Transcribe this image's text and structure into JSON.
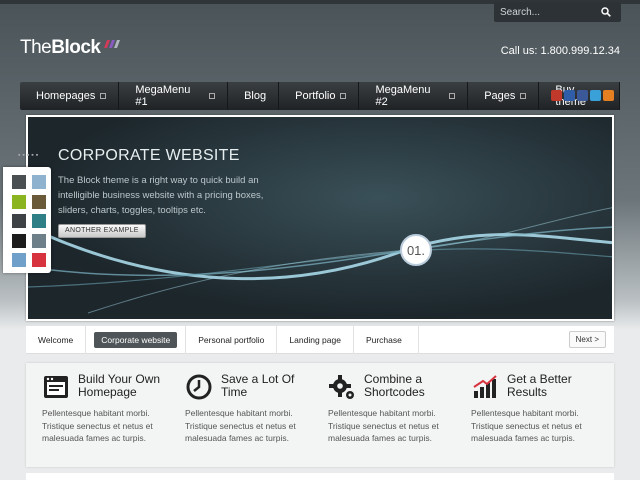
{
  "header": {
    "logo_light": "The",
    "logo_bold": "Block",
    "phone": "Call us: 1.800.999.12.34",
    "search": {
      "placeholder": "Search..."
    }
  },
  "nav": {
    "items": [
      {
        "label": "Homepages",
        "has_sub": true
      },
      {
        "label": "MegaMenu #1",
        "has_sub": true
      },
      {
        "label": "Blog",
        "has_sub": false
      },
      {
        "label": "Portfolio",
        "has_sub": true
      },
      {
        "label": "MegaMenu #2",
        "has_sub": true
      },
      {
        "label": "Pages",
        "has_sub": true
      },
      {
        "label": "Buy theme",
        "has_sub": false
      }
    ],
    "social_icons": [
      "youtube-icon",
      "flickr-icon",
      "facebook-icon",
      "twitter-icon",
      "rss-icon"
    ]
  },
  "slider": {
    "title": "CORPORATE WEBSITE",
    "text": "The Block theme is a right way to quick build an intelligible business website with a pricing boxes, sliders, charts, toggles, tooltips etc.",
    "button": "ANOTHER EXAMPLE",
    "number": "01."
  },
  "palette": {
    "colors": [
      "#4a4f52",
      "#8fb3cf",
      "#8ab420",
      "#6b5a3a",
      "#3e4244",
      "#2e7f86",
      "#1c1c1c",
      "#6d7f88",
      "#6fa0c9",
      "#d7333e"
    ]
  },
  "tabs": {
    "items": [
      "Welcome",
      "Corporate website",
      "Personal portfolio",
      "Landing page",
      "Purchase"
    ],
    "active_index": 1,
    "next_label": "Next >"
  },
  "features": [
    {
      "title": "Build Your Own Homepage",
      "text": "Pellentesque habitant morbi. Tristique senectus et netus et malesuada fames ac turpis.",
      "icon": "browser-window-icon"
    },
    {
      "title": "Save a Lot Of Time",
      "text": "Pellentesque habitant morbi. Tristique senectus et netus et malesuada fames ac turpis.",
      "icon": "clock-icon"
    },
    {
      "title": "Combine a Shortcodes",
      "text": "Pellentesque habitant morbi. Tristique senectus et netus et malesuada fames ac turpis.",
      "icon": "gears-icon"
    },
    {
      "title": "Get a Better Results",
      "text": "Pellentesque habitant morbi. Tristique senectus et netus et malesuada fames ac turpis.",
      "icon": "bar-chart-icon"
    }
  ]
}
